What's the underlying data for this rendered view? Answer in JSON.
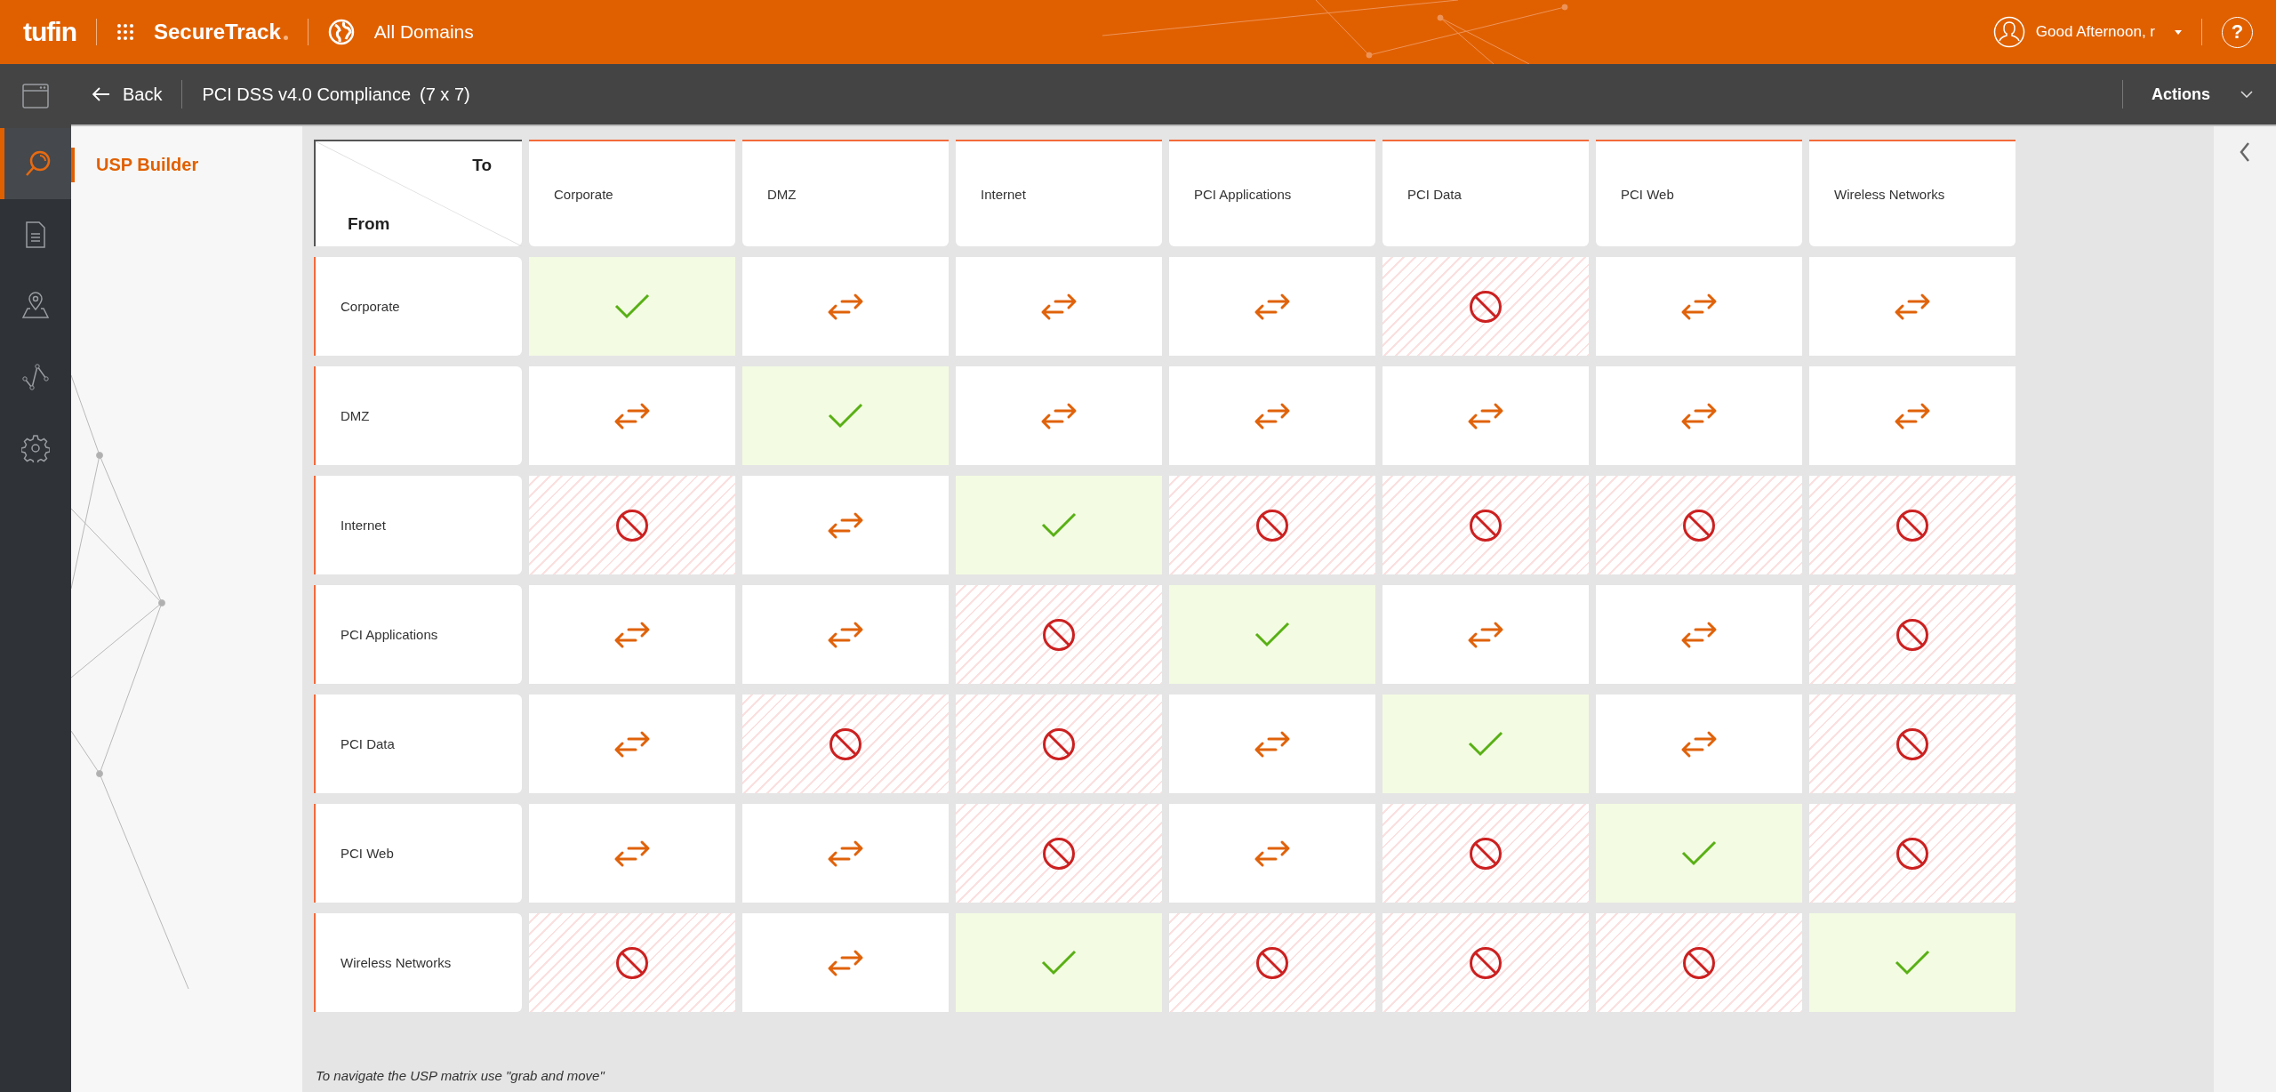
{
  "top_bar": {
    "logo": "tufin",
    "product": "SecureTrack",
    "domain": "All Domains",
    "greeting": "Good Afternoon, r",
    "help": "?"
  },
  "sub_bar": {
    "back": "Back",
    "title": "PCI DSS v4.0 Compliance",
    "size": "(7 x 7)",
    "actions": "Actions"
  },
  "rail": [
    {
      "selected": false
    },
    {
      "selected": true
    },
    {
      "selected": false
    },
    {
      "selected": false
    },
    {
      "selected": false
    },
    {
      "selected": false
    }
  ],
  "side_panel": {
    "items": [
      {
        "label": "USP Builder",
        "selected": true
      }
    ]
  },
  "matrix": {
    "to_label": "To",
    "from_label": "From",
    "columns": [
      "Corporate",
      "DMZ",
      "Internet",
      "PCI Applications",
      "PCI Data",
      "PCI Web",
      "Wireless Networks"
    ],
    "rows": [
      {
        "name": "Corporate",
        "cells": [
          {
            "kind": "check"
          },
          {
            "kind": "arrows"
          },
          {
            "kind": "arrows"
          },
          {
            "kind": "arrows"
          },
          {
            "kind": "blocked"
          },
          {
            "kind": "arrows"
          },
          {
            "kind": "arrows"
          }
        ]
      },
      {
        "name": "DMZ",
        "cells": [
          {
            "kind": "arrows"
          },
          {
            "kind": "check"
          },
          {
            "kind": "arrows"
          },
          {
            "kind": "arrows"
          },
          {
            "kind": "arrows"
          },
          {
            "kind": "arrows"
          },
          {
            "kind": "arrows"
          }
        ]
      },
      {
        "name": "Internet",
        "cells": [
          {
            "kind": "blocked"
          },
          {
            "kind": "arrows"
          },
          {
            "kind": "check"
          },
          {
            "kind": "blocked"
          },
          {
            "kind": "blocked"
          },
          {
            "kind": "blocked"
          },
          {
            "kind": "blocked"
          }
        ]
      },
      {
        "name": "PCI Applications",
        "cells": [
          {
            "kind": "arrows"
          },
          {
            "kind": "arrows"
          },
          {
            "kind": "blocked"
          },
          {
            "kind": "check"
          },
          {
            "kind": "arrows"
          },
          {
            "kind": "arrows"
          },
          {
            "kind": "blocked"
          }
        ]
      },
      {
        "name": "PCI Data",
        "cells": [
          {
            "kind": "arrows"
          },
          {
            "kind": "blocked"
          },
          {
            "kind": "blocked"
          },
          {
            "kind": "arrows"
          },
          {
            "kind": "check"
          },
          {
            "kind": "arrows"
          },
          {
            "kind": "blocked"
          }
        ]
      },
      {
        "name": "PCI Web",
        "cells": [
          {
            "kind": "arrows"
          },
          {
            "kind": "arrows"
          },
          {
            "kind": "blocked"
          },
          {
            "kind": "arrows"
          },
          {
            "kind": "blocked"
          },
          {
            "kind": "check"
          },
          {
            "kind": "blocked"
          }
        ]
      },
      {
        "name": "Wireless Networks",
        "cells": [
          {
            "kind": "blocked"
          },
          {
            "kind": "arrows"
          },
          {
            "kind": "check"
          },
          {
            "kind": "blocked"
          },
          {
            "kind": "blocked"
          },
          {
            "kind": "blocked"
          },
          {
            "kind": "check"
          }
        ]
      }
    ]
  },
  "footnote": "To navigate the USP matrix use \"grab and move\""
}
